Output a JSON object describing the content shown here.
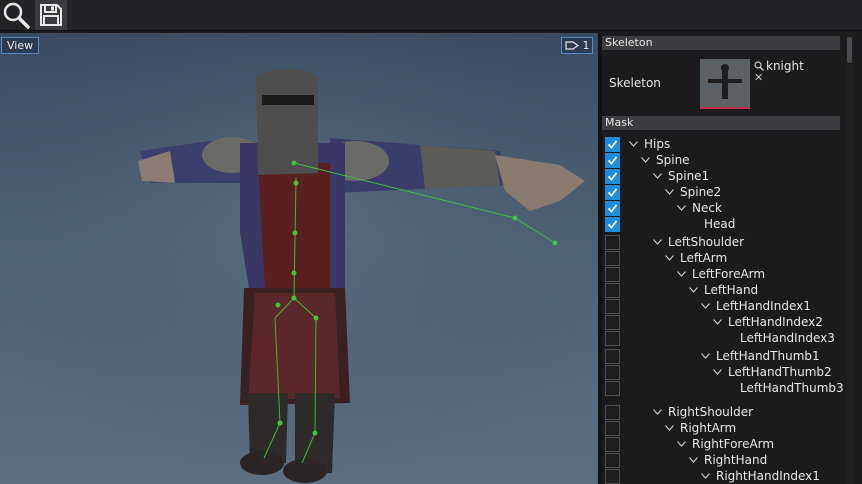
{
  "toolbar": {
    "search_icon": "search-icon",
    "save_icon": "save-icon"
  },
  "viewport": {
    "view_button": "View",
    "camera_index": "1"
  },
  "skeleton": {
    "header": "Skeleton",
    "label": "Skeleton",
    "asset_name": "knight",
    "clear": "✕"
  },
  "mask": {
    "header": "Mask",
    "rows": [
      {
        "label": "Hips",
        "checked": true,
        "chevron": true,
        "top": 0
      },
      {
        "label": "Spine",
        "checked": true,
        "chevron": true,
        "top": 0
      },
      {
        "label": "Spine1",
        "checked": true,
        "chevron": true,
        "top": 0
      },
      {
        "label": "Spine2",
        "checked": true,
        "chevron": true,
        "top": 0
      },
      {
        "label": "Neck",
        "checked": true,
        "chevron": true,
        "top": 0
      },
      {
        "label": "Head",
        "checked": true,
        "chevron": false,
        "top": 0
      },
      {
        "label": "LeftShoulder",
        "checked": false,
        "chevron": true,
        "top": 0
      },
      {
        "label": "LeftArm",
        "checked": false,
        "chevron": true,
        "top": 0
      },
      {
        "label": "LeftForeArm",
        "checked": false,
        "chevron": true,
        "top": 0
      },
      {
        "label": "LeftHand",
        "checked": false,
        "chevron": true,
        "top": 0
      },
      {
        "label": "LeftHandIndex1",
        "checked": false,
        "chevron": true,
        "top": 0
      },
      {
        "label": "LeftHandIndex2",
        "checked": false,
        "chevron": true,
        "top": 0
      },
      {
        "label": "LeftHandIndex3",
        "checked": false,
        "chevron": false,
        "top": 0
      },
      {
        "label": "LeftHandThumb1",
        "checked": false,
        "chevron": true,
        "top": 0
      },
      {
        "label": "LeftHandThumb2",
        "checked": false,
        "chevron": true,
        "top": 0
      },
      {
        "label": "LeftHandThumb3",
        "checked": false,
        "chevron": false,
        "top": 0
      },
      {
        "label": "RightShoulder",
        "checked": false,
        "chevron": true,
        "top": 0
      },
      {
        "label": "RightArm",
        "checked": false,
        "chevron": true,
        "top": 0
      },
      {
        "label": "RightForeArm",
        "checked": false,
        "chevron": true,
        "top": 0
      },
      {
        "label": "RightHand",
        "checked": false,
        "chevron": true,
        "top": 0
      },
      {
        "label": "RightHandIndex1",
        "checked": false,
        "chevron": true,
        "top": 0
      }
    ]
  },
  "colors": {
    "accent": "#1f8ad6",
    "panel": "#1b1b1d",
    "header": "#3c3c41"
  }
}
